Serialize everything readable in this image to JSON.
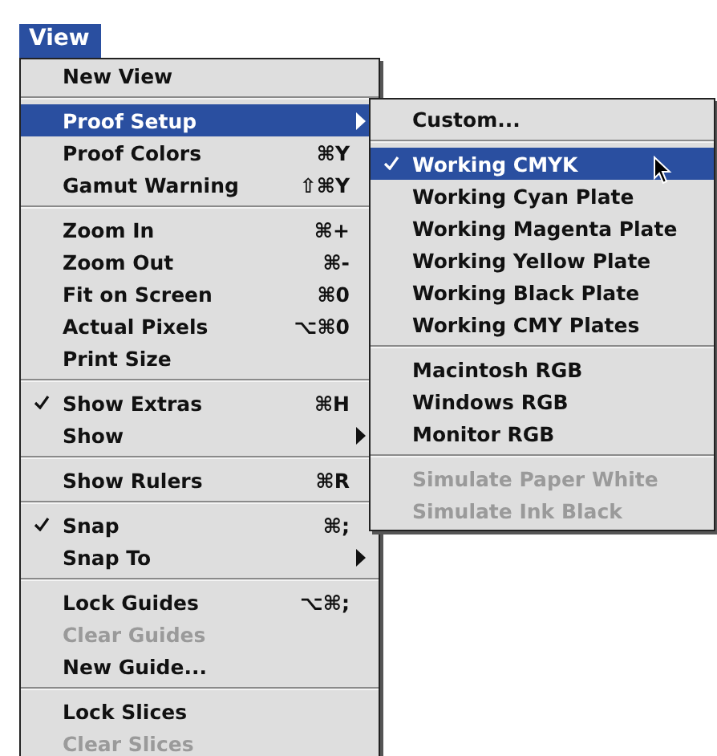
{
  "menu_title": "View",
  "menu": {
    "items": [
      {
        "kind": "item",
        "label": "New View",
        "checked": false,
        "disabled": false,
        "selected": false,
        "submenu": false
      },
      {
        "kind": "separator"
      },
      {
        "kind": "item",
        "label": "Proof Setup",
        "checked": false,
        "disabled": false,
        "selected": true,
        "submenu": true
      },
      {
        "kind": "item",
        "label": "Proof Colors",
        "shortcut": "⌘Y",
        "checked": false,
        "disabled": false,
        "selected": false,
        "submenu": false
      },
      {
        "kind": "item",
        "label": "Gamut Warning",
        "shortcut": "⇧⌘Y",
        "checked": false,
        "disabled": false,
        "selected": false,
        "submenu": false
      },
      {
        "kind": "separator"
      },
      {
        "kind": "item",
        "label": "Zoom In",
        "shortcut": "⌘+",
        "checked": false,
        "disabled": false,
        "selected": false,
        "submenu": false
      },
      {
        "kind": "item",
        "label": "Zoom Out",
        "shortcut": "⌘-",
        "checked": false,
        "disabled": false,
        "selected": false,
        "submenu": false
      },
      {
        "kind": "item",
        "label": "Fit on Screen",
        "shortcut": "⌘0",
        "checked": false,
        "disabled": false,
        "selected": false,
        "submenu": false
      },
      {
        "kind": "item",
        "label": "Actual Pixels",
        "shortcut": "⌥⌘0",
        "checked": false,
        "disabled": false,
        "selected": false,
        "submenu": false
      },
      {
        "kind": "item",
        "label": "Print Size",
        "checked": false,
        "disabled": false,
        "selected": false,
        "submenu": false
      },
      {
        "kind": "separator"
      },
      {
        "kind": "item",
        "label": "Show Extras",
        "shortcut": "⌘H",
        "checked": true,
        "disabled": false,
        "selected": false,
        "submenu": false
      },
      {
        "kind": "item",
        "label": "Show",
        "checked": false,
        "disabled": false,
        "selected": false,
        "submenu": true
      },
      {
        "kind": "separator"
      },
      {
        "kind": "item",
        "label": "Show Rulers",
        "shortcut": "⌘R",
        "checked": false,
        "disabled": false,
        "selected": false,
        "submenu": false
      },
      {
        "kind": "separator"
      },
      {
        "kind": "item",
        "label": "Snap",
        "shortcut": "⌘;",
        "checked": true,
        "disabled": false,
        "selected": false,
        "submenu": false
      },
      {
        "kind": "item",
        "label": "Snap To",
        "checked": false,
        "disabled": false,
        "selected": false,
        "submenu": true
      },
      {
        "kind": "separator"
      },
      {
        "kind": "item",
        "label": "Lock Guides",
        "shortcut": "⌥⌘;",
        "checked": false,
        "disabled": false,
        "selected": false,
        "submenu": false
      },
      {
        "kind": "item",
        "label": "Clear Guides",
        "checked": false,
        "disabled": true,
        "selected": false,
        "submenu": false
      },
      {
        "kind": "item",
        "label": "New Guide...",
        "checked": false,
        "disabled": false,
        "selected": false,
        "submenu": false
      },
      {
        "kind": "separator"
      },
      {
        "kind": "item",
        "label": "Lock Slices",
        "checked": false,
        "disabled": false,
        "selected": false,
        "submenu": false
      },
      {
        "kind": "item",
        "label": "Clear Slices",
        "checked": false,
        "disabled": true,
        "selected": false,
        "submenu": false
      }
    ]
  },
  "submenu": {
    "items": [
      {
        "kind": "item",
        "label": "Custom...",
        "checked": false,
        "disabled": false,
        "selected": false
      },
      {
        "kind": "separator"
      },
      {
        "kind": "item",
        "label": "Working CMYK",
        "checked": true,
        "disabled": false,
        "selected": true
      },
      {
        "kind": "item",
        "label": "Working Cyan Plate",
        "checked": false,
        "disabled": false,
        "selected": false
      },
      {
        "kind": "item",
        "label": "Working Magenta Plate",
        "checked": false,
        "disabled": false,
        "selected": false
      },
      {
        "kind": "item",
        "label": "Working Yellow Plate",
        "checked": false,
        "disabled": false,
        "selected": false
      },
      {
        "kind": "item",
        "label": "Working Black Plate",
        "checked": false,
        "disabled": false,
        "selected": false
      },
      {
        "kind": "item",
        "label": "Working CMY Plates",
        "checked": false,
        "disabled": false,
        "selected": false
      },
      {
        "kind": "separator"
      },
      {
        "kind": "item",
        "label": "Macintosh RGB",
        "checked": false,
        "disabled": false,
        "selected": false
      },
      {
        "kind": "item",
        "label": "Windows RGB",
        "checked": false,
        "disabled": false,
        "selected": false
      },
      {
        "kind": "item",
        "label": "Monitor RGB",
        "checked": false,
        "disabled": false,
        "selected": false
      },
      {
        "kind": "separator"
      },
      {
        "kind": "item",
        "label": "Simulate Paper White",
        "checked": false,
        "disabled": true,
        "selected": false
      },
      {
        "kind": "item",
        "label": "Simulate Ink Black",
        "checked": false,
        "disabled": true,
        "selected": false
      }
    ]
  }
}
